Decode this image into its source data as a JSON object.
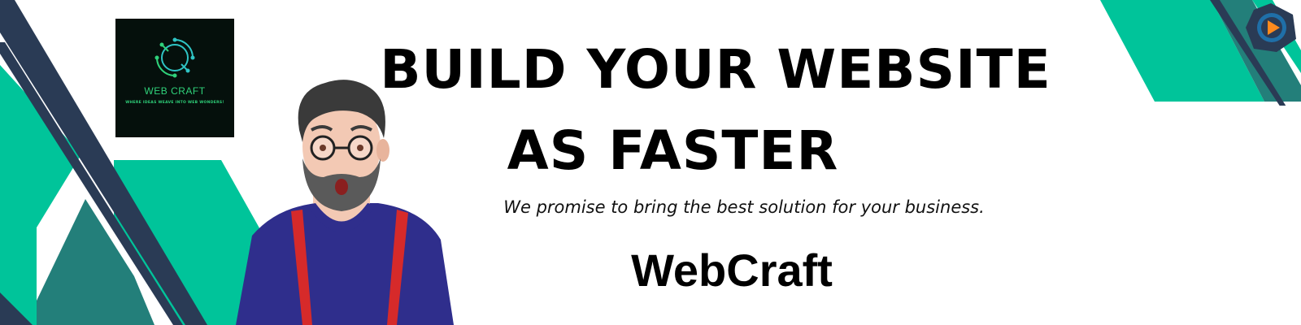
{
  "logo": {
    "icon": "circuit-emblem",
    "name": "WEB CRAFT",
    "tagline": "WHERE IDEAS WEAVE INTO WEB WONDERS!"
  },
  "headline": {
    "line1": "BUILD YOUR WEBSITE",
    "line2": "AS FASTER"
  },
  "tagline": "We promise to bring the best solution for your business.",
  "brand_name": "WebCraft",
  "corner_icon": "play-badge-icon",
  "colors": {
    "teal": "#00c49a",
    "dark_teal": "#237f7a",
    "navy": "#2a3b55",
    "shirt": "#2f2e8c",
    "suspenders": "#d62a2a",
    "logo_bg": "#05100c",
    "logo_green": "#2fd17a"
  }
}
